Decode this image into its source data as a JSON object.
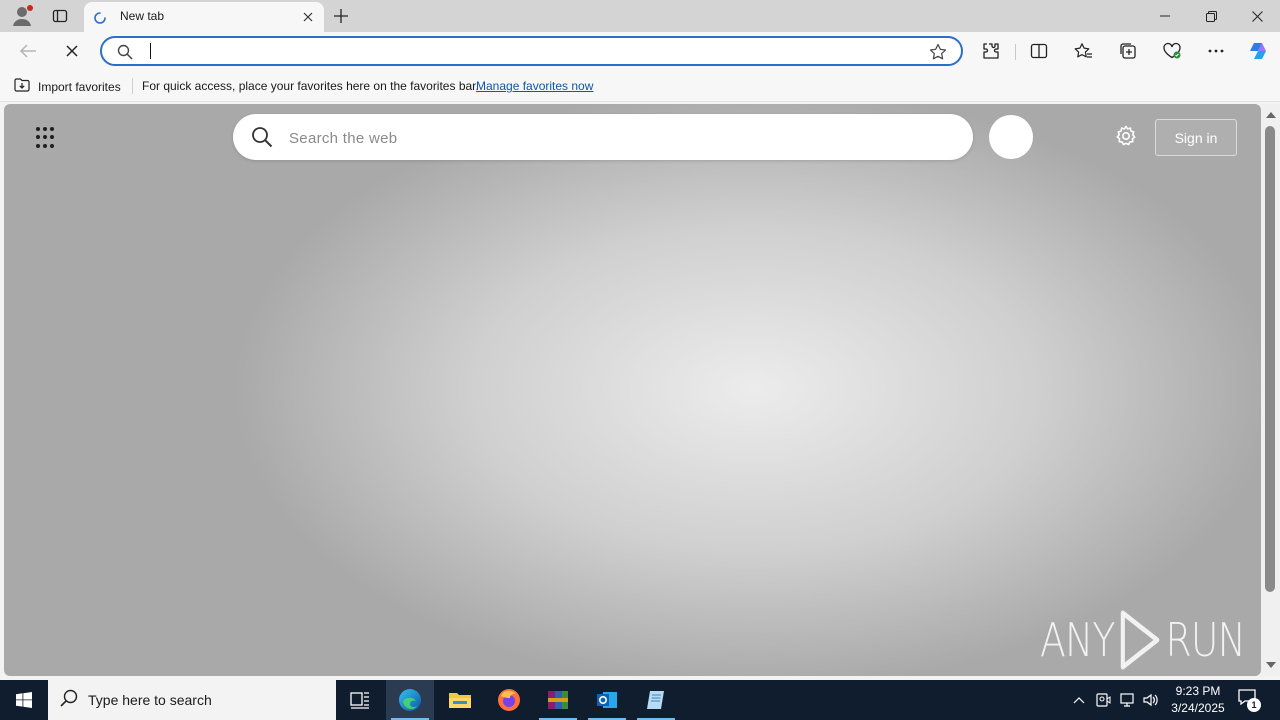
{
  "browser": {
    "tab": {
      "title": "New tab"
    },
    "toolbar": {
      "address_value": "",
      "address_placeholder": ""
    },
    "favorites_bar": {
      "import_label": "Import favorites",
      "message": "For quick access, place your favorites here on the favorites bar.",
      "manage_link": "Manage favorites now"
    }
  },
  "new_tab_page": {
    "search_placeholder": "Search the web",
    "signin_label": "Sign in",
    "watermark_left": "ANY",
    "watermark_right": "RUN"
  },
  "taskbar": {
    "search_placeholder": "Type here to search",
    "apps": [
      "task-view",
      "edge",
      "file-explorer",
      "firefox",
      "winrar",
      "outlook",
      "notepad"
    ],
    "active_app": "edge",
    "clock_time": "9:23 PM",
    "clock_date": "3/24/2025",
    "notification_count": "1"
  },
  "colors": {
    "accent": "#2a6fc9",
    "link": "#0b57a8",
    "taskbar": "#101d2e",
    "copilot": "#2b7de9"
  }
}
